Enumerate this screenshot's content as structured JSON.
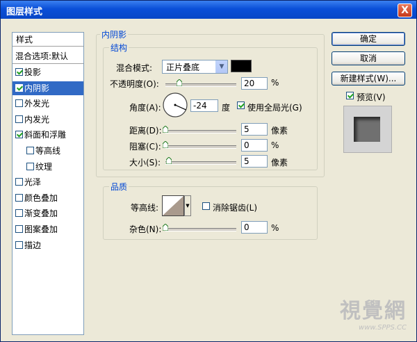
{
  "window": {
    "title": "图层样式",
    "close": "X"
  },
  "styles_panel": {
    "header": "样式",
    "blend_options": "混合选项:默认",
    "items": [
      {
        "label": "投影",
        "checked": true,
        "selected": false,
        "indent": false
      },
      {
        "label": "内阴影",
        "checked": true,
        "selected": true,
        "indent": false
      },
      {
        "label": "外发光",
        "checked": false,
        "selected": false,
        "indent": false
      },
      {
        "label": "内发光",
        "checked": false,
        "selected": false,
        "indent": false
      },
      {
        "label": "斜面和浮雕",
        "checked": true,
        "selected": false,
        "indent": false
      },
      {
        "label": "等高线",
        "checked": false,
        "selected": false,
        "indent": true
      },
      {
        "label": "纹理",
        "checked": false,
        "selected": false,
        "indent": true
      },
      {
        "label": "光泽",
        "checked": false,
        "selected": false,
        "indent": false
      },
      {
        "label": "颜色叠加",
        "checked": false,
        "selected": false,
        "indent": false
      },
      {
        "label": "渐变叠加",
        "checked": false,
        "selected": false,
        "indent": false
      },
      {
        "label": "图案叠加",
        "checked": false,
        "selected": false,
        "indent": false
      },
      {
        "label": "描边",
        "checked": false,
        "selected": false,
        "indent": false
      }
    ]
  },
  "inner_shadow": {
    "group_title": "内阴影",
    "structure": {
      "title": "结构",
      "blend_mode_label": "混合模式:",
      "blend_mode_value": "正片叠底",
      "shadow_color": "#000000",
      "opacity_label": "不透明度(O):",
      "opacity_value": "20",
      "opacity_unit": "%",
      "angle_label": "角度(A):",
      "angle_value": "-24",
      "angle_unit": "度",
      "global_light_label": "使用全局光(G)",
      "global_light_checked": true,
      "distance_label": "距离(D):",
      "distance_value": "5",
      "distance_unit": "像素",
      "choke_label": "阻塞(C):",
      "choke_value": "0",
      "choke_unit": "%",
      "size_label": "大小(S):",
      "size_value": "5",
      "size_unit": "像素"
    },
    "quality": {
      "title": "品质",
      "contour_label": "等高线:",
      "anti_alias_label": "消除锯齿(L)",
      "anti_alias_checked": false,
      "noise_label": "杂色(N):",
      "noise_value": "0",
      "noise_unit": "%"
    }
  },
  "buttons": {
    "ok": "确定",
    "cancel": "取消",
    "new_style": "新建样式(W)...",
    "preview_label": "预览(V)",
    "preview_checked": true
  },
  "watermark": {
    "text": "視覺網",
    "url": "www.SPPS.CC"
  }
}
